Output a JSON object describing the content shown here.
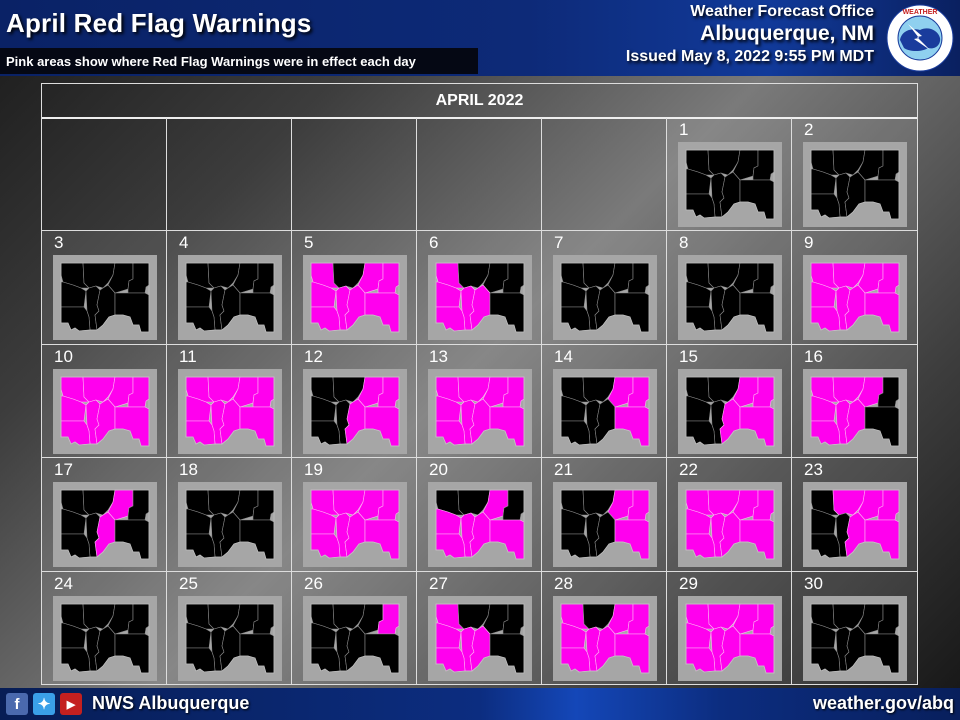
{
  "header": {
    "title": "April Red Flag Warnings",
    "subtitle": "Pink areas show where Red Flag Warnings were in effect each day",
    "office_line1": "Weather Forecast Office",
    "office_line2": "Albuquerque, NM",
    "issued": "Issued May 8, 2022 9:55 PM MDT",
    "logo_text": "NATIONAL WEATHER SERVICE"
  },
  "calendar": {
    "month_label": "APRIL 2022",
    "leading_blank_days": 5,
    "colors": {
      "warning": "#ff00ee",
      "no_warning": "#000000",
      "outside": "#a6a6a6",
      "border": "#c0c0c0"
    },
    "zone_names": [
      "NW",
      "N-Central",
      "NE-Inner",
      "NE-Far",
      "W-Central",
      "Central-West",
      "Central-East",
      "SE",
      "SW"
    ],
    "days": [
      {
        "day": "1",
        "pink": []
      },
      {
        "day": "2",
        "pink": []
      },
      {
        "day": "3",
        "pink": []
      },
      {
        "day": "4",
        "pink": []
      },
      {
        "day": "5",
        "pink": [
          "NW",
          "NE-Inner",
          "NE-Far",
          "W-Central",
          "Central-West",
          "Central-East",
          "SE",
          "SW"
        ]
      },
      {
        "day": "6",
        "pink": [
          "NW",
          "W-Central",
          "Central-West",
          "Central-East",
          "SW"
        ]
      },
      {
        "day": "7",
        "pink": []
      },
      {
        "day": "8",
        "pink": []
      },
      {
        "day": "9",
        "pink": [
          "NW",
          "N-Central",
          "NE-Inner",
          "NE-Far",
          "W-Central",
          "Central-West",
          "Central-East",
          "SE",
          "SW"
        ]
      },
      {
        "day": "10",
        "pink": [
          "NW",
          "N-Central",
          "NE-Inner",
          "NE-Far",
          "W-Central",
          "Central-West",
          "Central-East",
          "SE",
          "SW"
        ]
      },
      {
        "day": "11",
        "pink": [
          "NW",
          "N-Central",
          "NE-Inner",
          "NE-Far",
          "W-Central",
          "Central-West",
          "Central-East",
          "SE",
          "SW"
        ]
      },
      {
        "day": "12",
        "pink": [
          "NE-Inner",
          "NE-Far",
          "Central-East",
          "SE"
        ]
      },
      {
        "day": "13",
        "pink": [
          "NW",
          "N-Central",
          "NE-Inner",
          "NE-Far",
          "W-Central",
          "Central-West",
          "Central-East",
          "SE",
          "SW"
        ]
      },
      {
        "day": "14",
        "pink": [
          "NE-Inner",
          "NE-Far",
          "SE"
        ]
      },
      {
        "day": "15",
        "pink": [
          "NE-Inner",
          "NE-Far",
          "Central-East",
          "SE"
        ]
      },
      {
        "day": "16",
        "pink": [
          "NW",
          "N-Central",
          "NE-Inner",
          "W-Central",
          "Central-West",
          "Central-East",
          "SW"
        ]
      },
      {
        "day": "17",
        "pink": [
          "NE-Inner",
          "Central-East"
        ]
      },
      {
        "day": "18",
        "pink": []
      },
      {
        "day": "19",
        "pink": [
          "NW",
          "N-Central",
          "NE-Inner",
          "NE-Far",
          "W-Central",
          "Central-West",
          "Central-East",
          "SE",
          "SW"
        ]
      },
      {
        "day": "20",
        "pink": [
          "NE-Inner",
          "W-Central",
          "Central-West",
          "Central-East",
          "SE",
          "SW"
        ]
      },
      {
        "day": "21",
        "pink": [
          "NE-Inner",
          "NE-Far",
          "SE"
        ]
      },
      {
        "day": "22",
        "pink": [
          "NW",
          "N-Central",
          "NE-Inner",
          "NE-Far",
          "W-Central",
          "Central-West",
          "Central-East",
          "SE",
          "SW"
        ]
      },
      {
        "day": "23",
        "pink": [
          "N-Central",
          "NE-Inner",
          "NE-Far",
          "Central-East",
          "SE"
        ]
      },
      {
        "day": "24",
        "pink": []
      },
      {
        "day": "25",
        "pink": []
      },
      {
        "day": "26",
        "pink": [
          "NE-Far"
        ]
      },
      {
        "day": "27",
        "pink": [
          "NW",
          "W-Central",
          "Central-West",
          "Central-East",
          "SW"
        ]
      },
      {
        "day": "28",
        "pink": [
          "NW",
          "NE-Inner",
          "NE-Far",
          "W-Central",
          "Central-West",
          "Central-East",
          "SE",
          "SW"
        ]
      },
      {
        "day": "29",
        "pink": [
          "NW",
          "N-Central",
          "NE-Inner",
          "NE-Far",
          "W-Central",
          "Central-West",
          "Central-East",
          "SE",
          "SW"
        ]
      },
      {
        "day": "30",
        "pink": []
      }
    ]
  },
  "footer": {
    "social_icons": [
      "facebook-icon",
      "twitter-icon",
      "youtube-icon"
    ],
    "handle": "NWS Albuquerque",
    "website": "weather.gov/abq"
  }
}
